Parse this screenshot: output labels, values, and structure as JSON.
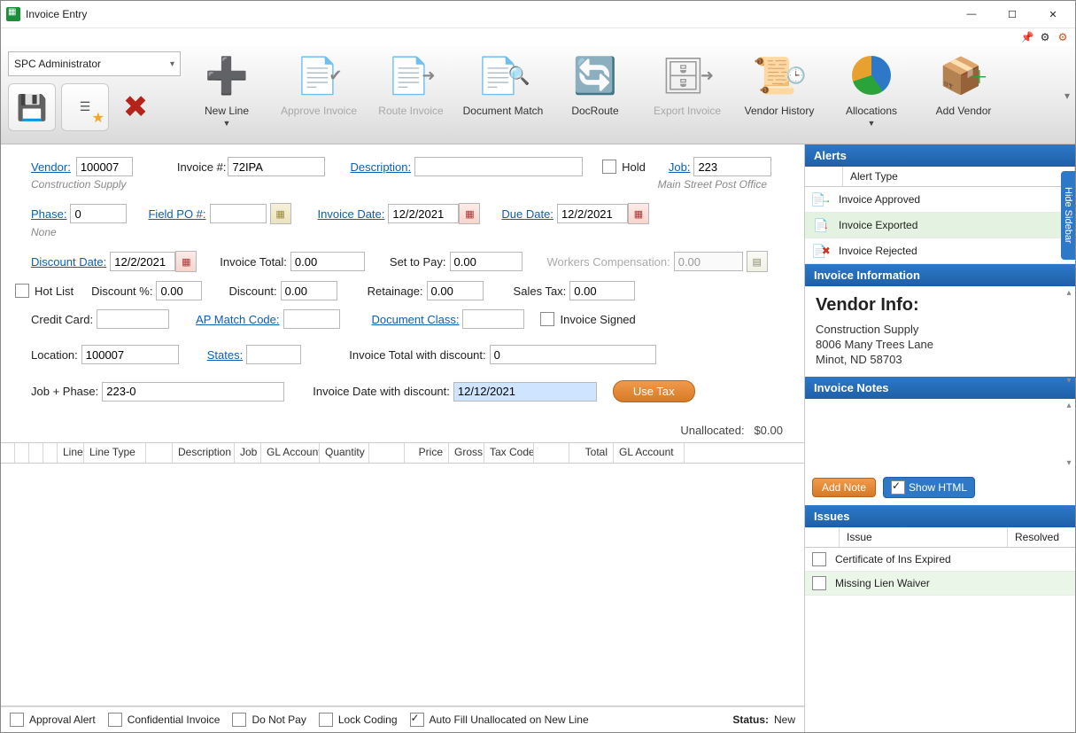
{
  "window": {
    "title": "Invoice Entry"
  },
  "user_dropdown": "SPC Administrator",
  "ribbon": [
    {
      "label": "New Line",
      "enabled": true,
      "more": true
    },
    {
      "label": "Approve Invoice",
      "enabled": false
    },
    {
      "label": "Route Invoice",
      "enabled": false
    },
    {
      "label": "Document Match",
      "enabled": true
    },
    {
      "label": "DocRoute",
      "enabled": true
    },
    {
      "label": "Export Invoice",
      "enabled": false
    },
    {
      "label": "Vendor History",
      "enabled": true
    },
    {
      "label": "Allocations",
      "enabled": true,
      "more": true
    },
    {
      "label": "Add Vendor",
      "enabled": true
    }
  ],
  "labels": {
    "vendor": "Vendor:",
    "invoice_no": "Invoice #: ",
    "description": "Description:",
    "hold": "Hold",
    "job": "Job:",
    "phase": "Phase:",
    "field_po": "Field PO #:",
    "invoice_date": "Invoice Date:",
    "due_date": "Due Date:",
    "discount_date": "Discount Date:",
    "invoice_total": "Invoice Total:",
    "set_to_pay": "Set to Pay:",
    "workers_comp": "Workers Compensation:",
    "hot_list": "Hot List",
    "discount_pct": "Discount %:",
    "discount": "Discount:",
    "retainage": "Retainage:",
    "sales_tax": "Sales Tax:",
    "credit_card": "Credit Card:",
    "ap_match": "AP Match Code:",
    "doc_class": "Document Class:",
    "invoice_signed": "Invoice Signed",
    "location": "Location:",
    "states": "States:",
    "total_with_disc": "Invoice Total with discount:",
    "job_phase": "Job + Phase:",
    "date_with_disc": "Invoice Date with discount:",
    "use_tax": "Use Tax",
    "unalloc_label": "Unallocated:",
    "unalloc_value": "$0.00",
    "approval_alert": "Approval Alert",
    "confidential": "Confidential Invoice",
    "do_not_pay": "Do Not Pay",
    "lock_coding": "Lock Coding",
    "autofill": "Auto Fill Unallocated on New Line",
    "status_label": "Status:",
    "status_value": "New"
  },
  "values": {
    "vendor": "100007",
    "vendor_name": "Construction Supply",
    "invoice_no": "72IPA",
    "description": "",
    "job": "223",
    "job_name": "Main Street Post Office",
    "phase": "0",
    "phase_name": "None",
    "field_po": "",
    "invoice_date": "12/2/2021",
    "due_date": "12/2/2021",
    "discount_date": "12/2/2021",
    "invoice_total": "0.00",
    "set_to_pay": "0.00",
    "workers_comp": "0.00",
    "discount_pct": "0.00",
    "discount": "0.00",
    "retainage": "0.00",
    "sales_tax": "0.00",
    "credit_card": "",
    "ap_match": "",
    "doc_class": "",
    "location": "100007",
    "states": "",
    "total_with_disc": "0",
    "job_phase": "223-0",
    "date_with_disc": "12/12/2021"
  },
  "grid_cols": [
    "",
    "",
    "",
    "",
    "Line",
    "Line Type",
    "",
    "Description",
    "Job",
    "GL Account",
    "Quantity",
    "",
    "Price",
    "Gross",
    "Tax Code",
    "",
    "Total",
    "GL Account"
  ],
  "sidebar": {
    "alerts_title": "Alerts",
    "alerts_col": "Alert Type",
    "alerts": [
      {
        "text": "Invoice Approved",
        "icon": "→",
        "color": "#2aa33a",
        "hl": false
      },
      {
        "text": "Invoice Exported",
        "icon": "↓",
        "color": "#c0392b",
        "hl": true
      },
      {
        "text": "Invoice Rejected",
        "icon": "✖",
        "color": "#c0392b",
        "hl": false
      }
    ],
    "info_title": "Invoice Information",
    "vendor_heading": "Vendor Info:",
    "vendor_lines": [
      "Construction Supply",
      "8006 Many Trees Lane",
      "Minot, ND 58703"
    ],
    "notes_title": "Invoice Notes",
    "add_note": "Add Note",
    "show_html": "Show HTML",
    "issues_title": "Issues",
    "issue_col": "Issue",
    "resolved_col": "Resolved",
    "issues": [
      {
        "text": "Certificate of Ins Expired",
        "hl": false
      },
      {
        "text": "Missing Lien Waiver",
        "hl": true
      }
    ],
    "hide_sidebar": "Hide Sidebar"
  }
}
